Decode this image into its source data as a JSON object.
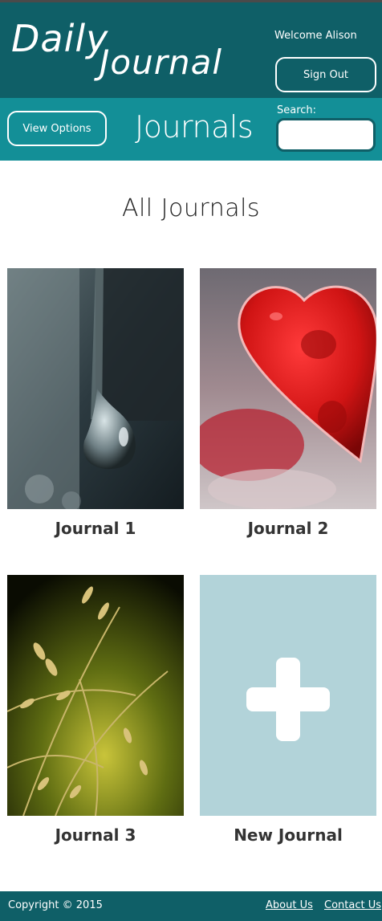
{
  "brand": {
    "line1": "Daily",
    "line2": "Journal"
  },
  "header": {
    "welcome": "Welcome Alison",
    "signout_label": "Sign Out"
  },
  "toolbar": {
    "view_options_label": "View Options",
    "section_title": "Journals",
    "search_label": "Search:",
    "search_value": ""
  },
  "main": {
    "heading": "All Journals",
    "journals": [
      {
        "label": "Journal 1",
        "image": "water-droplet-photo"
      },
      {
        "label": "Journal 2",
        "image": "red-heart-ice-photo"
      },
      {
        "label": "Journal 3",
        "image": "grass-seedheads-photo"
      },
      {
        "label": "New Journal",
        "image": "plus-icon"
      }
    ]
  },
  "footer": {
    "copyright": "Copyright © 2015",
    "links": [
      "About Us",
      "Contact Us"
    ]
  },
  "colors": {
    "header_dark": "#0f5f67",
    "header_teal": "#138f97",
    "new_tile": "#b2d3d9"
  }
}
